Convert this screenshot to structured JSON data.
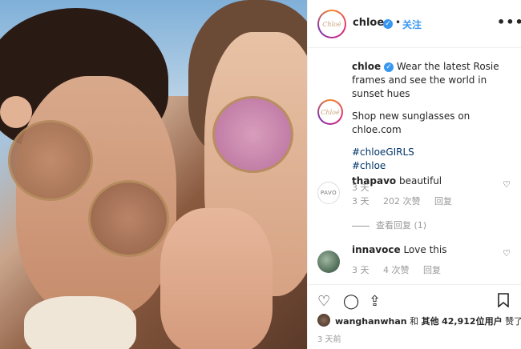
{
  "header": {
    "avatar_text": "Chloé",
    "username": "chloe",
    "dot": "•",
    "follow": "关注",
    "more": "•••"
  },
  "caption": {
    "username": "chloe",
    "text": "Wear the latest Rosie frames and see the world in sunset hues",
    "shop": "Shop new sunglasses on chloe.com",
    "hashtag1": "#chloeGIRLS",
    "hashtag2": "#chloe",
    "time": "3 天"
  },
  "comments": [
    {
      "avatar_text": "PAVO",
      "username": "thapavo",
      "text": "beautiful",
      "time": "3 天",
      "likes": "202 次赞",
      "reply": "回复",
      "view_replies": "查看回复 (1)"
    },
    {
      "username": "innavoce",
      "text": "Love this",
      "time": "3 天",
      "likes": "4 次赞",
      "reply": "回复"
    }
  ],
  "likes_line": {
    "user": "wanghanwhan",
    "and": "和",
    "others": "其他",
    "count": "42,912",
    "suffix": "位用户",
    "liked": "赞了"
  },
  "footer_time": "3 天前",
  "icons": [
    "verified-icon",
    "more-icon",
    "heart-icon",
    "comment-icon",
    "share-icon",
    "bookmark-icon"
  ]
}
